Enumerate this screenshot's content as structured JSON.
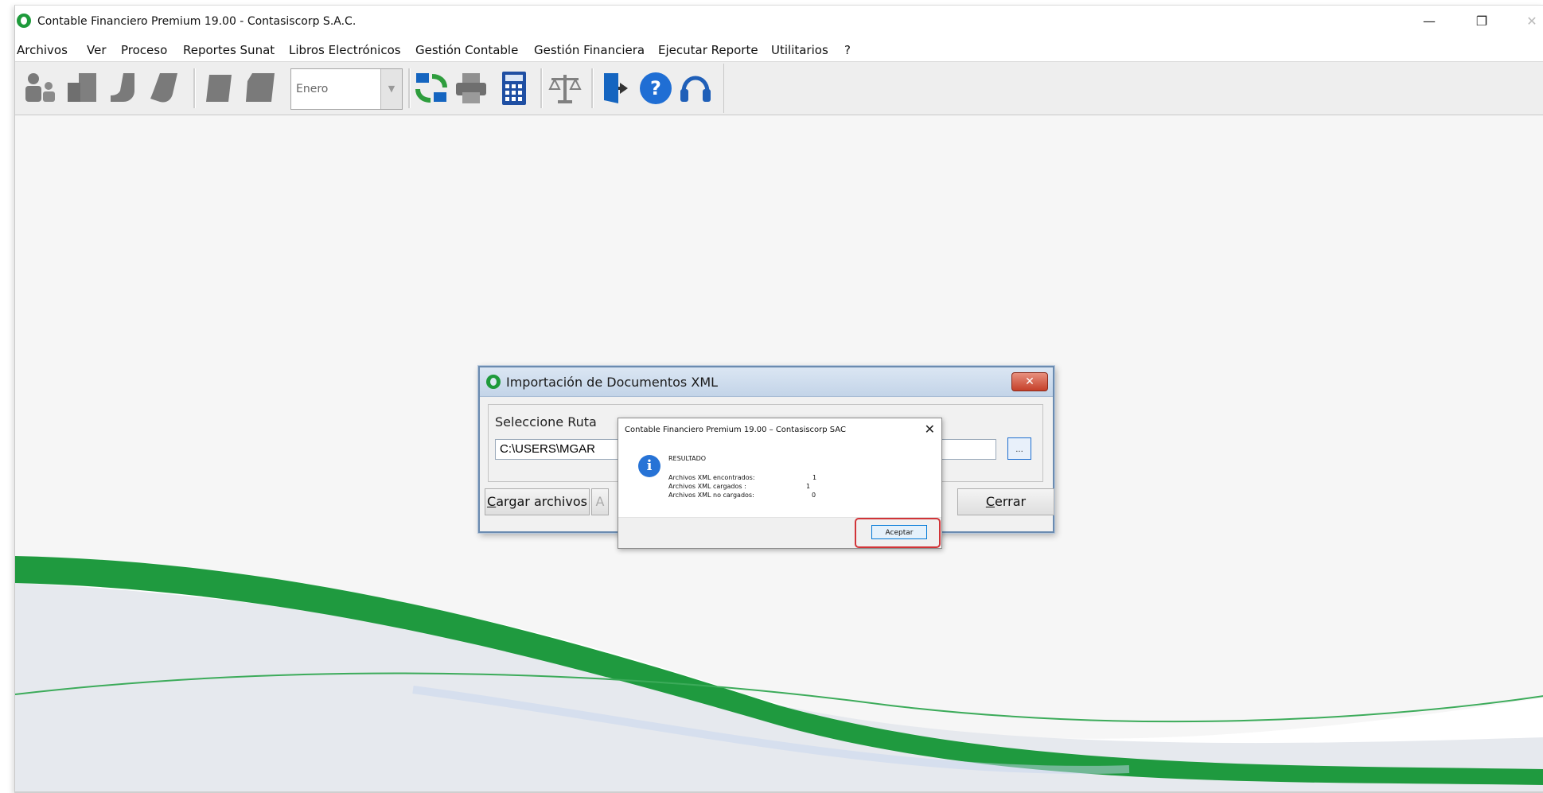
{
  "window": {
    "title": "Contable Financiero Premium 19.00 - Contasiscorp S.A.C.",
    "controls": {
      "minimize": "—",
      "restore": "❐",
      "close": "✕"
    }
  },
  "menu": {
    "items": [
      "Archivos",
      "Ver",
      "Proceso",
      "Reportes Sunat",
      "Libros Electrónicos",
      "Gestión Contable",
      "Gestión Financiera",
      "Ejecutar Reporte",
      "Utilitarios",
      "?"
    ]
  },
  "toolbar": {
    "month_value": "Enero",
    "icons": [
      "users-icon",
      "journal-icon",
      "boot-icon",
      "sock-icon",
      "folder-icon",
      "document-icon",
      "refresh-network-icon",
      "printer-icon",
      "calculator-icon",
      "balance-scale-icon",
      "exit-door-icon",
      "help-icon",
      "headset-icon"
    ]
  },
  "import_dialog": {
    "title": "Importación de Documentos XML",
    "close_label": "✕",
    "route_label": "Seleccione Ruta",
    "route_value": "C:\\USERS\\MGAR",
    "browse_label": "...",
    "load_button": "Cargar archivos",
    "load_button_mnemonic": "C",
    "load_button_rest": "argar archivos",
    "hidden_button": "A",
    "close_button_mnemonic": "C",
    "close_button_rest": "errar"
  },
  "message_box": {
    "title": "Contable Financiero Premium 19.00 – Contasiscorp SAC",
    "close_label": "✕",
    "heading": "RESULTADO",
    "lines": [
      {
        "label": "Archivos XML encontrados:",
        "value": "1"
      },
      {
        "label": "Archivos XML cargados   :",
        "value": "1"
      },
      {
        "label": "Archivos XML no cargados:",
        "value": "0"
      }
    ],
    "ok_button": "Aceptar"
  },
  "colors": {
    "brand_green": "#1e9a3b",
    "highlight_red": "#d13438",
    "info_blue": "#2773d6"
  }
}
